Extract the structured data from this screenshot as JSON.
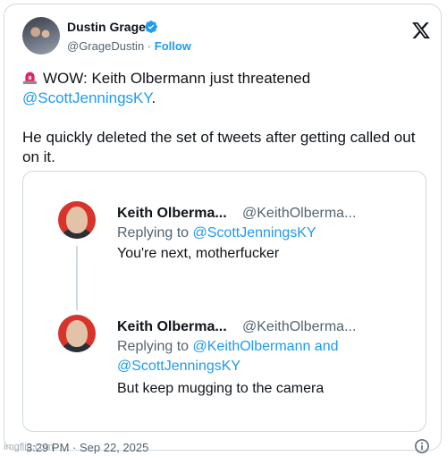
{
  "author": {
    "name": "Dustin Grage",
    "handle": "@GrageDustin",
    "separator": " · ",
    "follow_label": "Follow",
    "verified": true,
    "avatar_icon": "family-photo-avatar"
  },
  "platform_icon": "x-logo",
  "tweet": {
    "line1_icon": "siren-emoji",
    "line1_text": "WOW: Keith Olbermann just threatened",
    "line1_mention": "@ScottJenningsKY",
    "line1_end": ".",
    "line2": "He quickly deleted the set of tweets after getting called out on it."
  },
  "embedded": {
    "tweets": [
      {
        "name": "Keith Olberma...",
        "handle": "@KeithOlberma...",
        "reply_prefix": "Replying to ",
        "reply_mentions": [
          "@ScottJenningsKY"
        ],
        "body": "You're next, motherfucker"
      },
      {
        "name": "Keith Olberma...",
        "handle": "@KeithOlberma...",
        "reply_prefix": "Replying to ",
        "reply_mentions": [
          "@KeithOlbermann",
          "@ScottJenningsKY"
        ],
        "reply_joiner": " and",
        "body": "But keep mugging to the camera"
      }
    ]
  },
  "footer": {
    "timestamp": "3:29 PM · Sep 22, 2025",
    "info_icon": "info-icon"
  },
  "watermark": "imgflip.com",
  "colors": {
    "accent": "#1d9bf0",
    "text": "#0f1419",
    "muted": "#536471",
    "border": "#cfd9de",
    "avatar_red": "#d9342b"
  }
}
